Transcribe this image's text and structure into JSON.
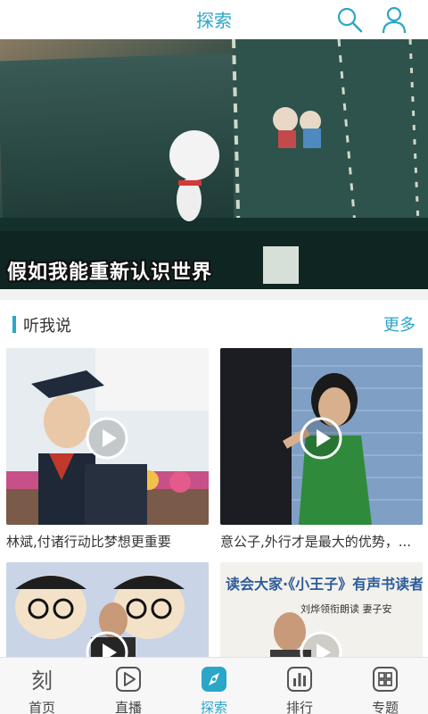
{
  "header": {
    "title": "探索"
  },
  "icons": {
    "search": "search-icon",
    "user": "user-icon"
  },
  "colors": {
    "accent": "#2aa6c9"
  },
  "banner": {
    "caption": "假如我能重新认识世界"
  },
  "section": {
    "title": "听我说",
    "more": "更多",
    "videos": [
      {
        "title": "林斌,付诸行动比梦想更重要"
      },
      {
        "title": "意公子,外行才是最大的优势，..."
      },
      {
        "title": ""
      },
      {
        "title": ""
      }
    ]
  },
  "tabbar": {
    "items": [
      {
        "label": "首页",
        "icon": "ke-logo-icon"
      },
      {
        "label": "直播",
        "icon": "play-icon"
      },
      {
        "label": "探索",
        "icon": "compass-icon",
        "active": true
      },
      {
        "label": "排行",
        "icon": "ranking-icon"
      },
      {
        "label": "专题",
        "icon": "grid-icon"
      }
    ]
  }
}
